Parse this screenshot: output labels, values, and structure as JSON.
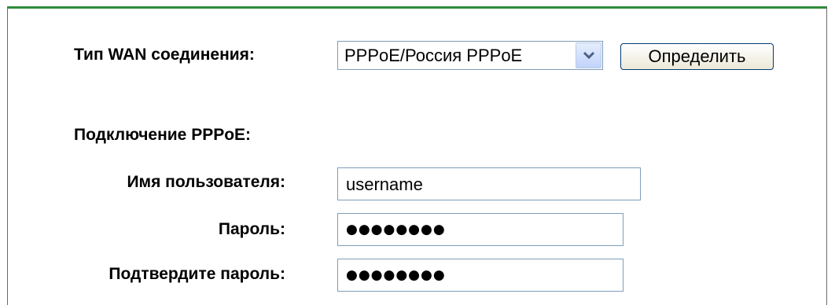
{
  "wan": {
    "type_label": "Тип WAN соединения:",
    "type_value": "PPPoE/Россия PPPoE",
    "detect_button_label": "Определить"
  },
  "pppoe": {
    "section_label": "Подключение PPPoE:",
    "username_label": "Имя пользователя:",
    "username_value": "username",
    "password_label": "Пароль:",
    "password_mask": "●●●●●●●●",
    "confirm_password_label": "Подтвердите пароль:",
    "confirm_password_mask": "●●●●●●●●"
  },
  "colors": {
    "top_rule": "#2e8b3a",
    "input_border": "#7f9db9",
    "button_border": "#003c74"
  }
}
